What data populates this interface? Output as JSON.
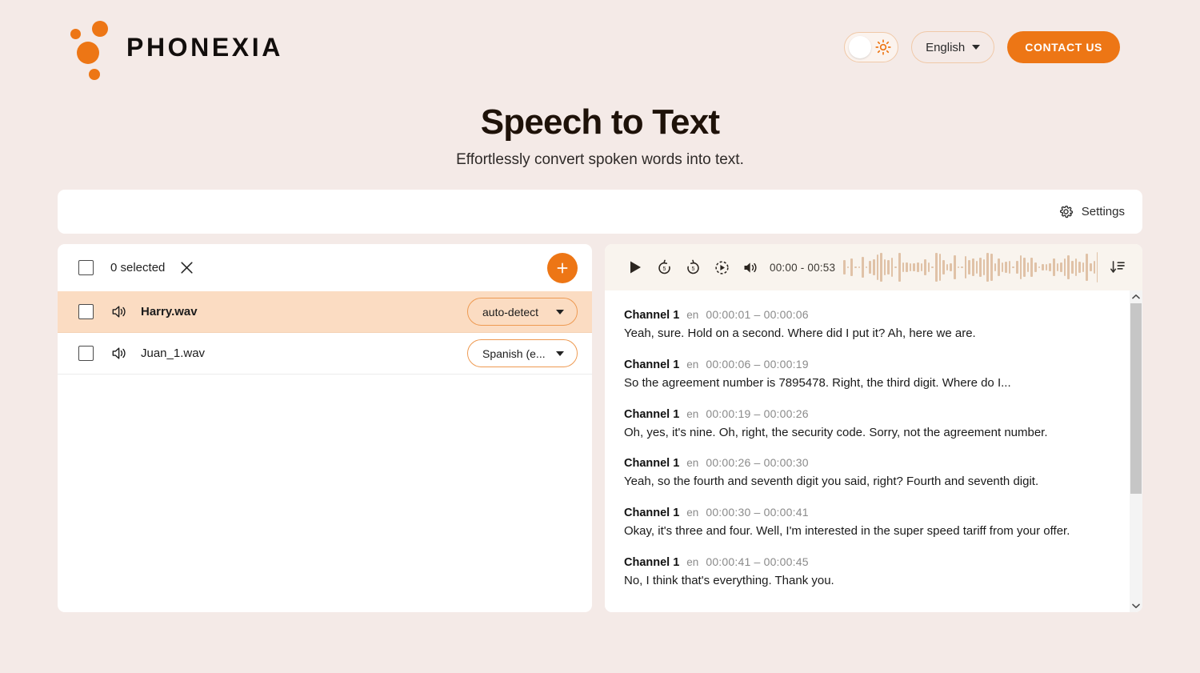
{
  "header": {
    "brand": "PHONEXIA",
    "logo_color": "#ED7615",
    "theme_toggle_icon": "sun-icon",
    "language": "English",
    "contact_label": "CONTACT US",
    "contact_color": "#ED7615"
  },
  "hero": {
    "title": "Speech to Text",
    "subtitle": "Effortlessly convert spoken words into text."
  },
  "settings_bar": {
    "icon": "gear-icon",
    "label": "Settings"
  },
  "files_panel": {
    "toolbar": {
      "selected_label": "0 selected",
      "clear_icon": "close-icon",
      "add_icon": "plus-icon"
    },
    "items": [
      {
        "icon": "speaker-icon",
        "name": "Harry.wav",
        "language": "auto-detect",
        "selected": false,
        "active": true
      },
      {
        "icon": "speaker-icon",
        "name": "Juan_1.wav",
        "language": "Spanish (e...",
        "selected": false,
        "active": false
      }
    ]
  },
  "player": {
    "controls": [
      {
        "icon": "play-icon",
        "name": "play-button"
      },
      {
        "icon": "rewind-5-icon",
        "name": "rewind-5s-button"
      },
      {
        "icon": "forward-5-icon",
        "name": "forward-5s-button"
      },
      {
        "icon": "playback-speed-icon",
        "name": "playback-speed-button"
      },
      {
        "icon": "volume-icon",
        "name": "volume-button"
      }
    ],
    "time": "00:00 - 00:53",
    "waveform_color": "#E0C2A7",
    "sort_icon": "sort-descending-icon"
  },
  "transcript": {
    "segments": [
      {
        "channel": "Channel 1",
        "lang": "en",
        "time": "00:00:01 – 00:00:06",
        "text": "Yeah, sure. Hold on a second. Where did I put it? Ah, here we are."
      },
      {
        "channel": "Channel 1",
        "lang": "en",
        "time": "00:00:06 – 00:00:19",
        "text": "So the agreement number is 7895478. Right, the third digit. Where do I..."
      },
      {
        "channel": "Channel 1",
        "lang": "en",
        "time": "00:00:19 – 00:00:26",
        "text": "Oh, yes, it's nine. Oh, right, the security code. Sorry, not the agreement number."
      },
      {
        "channel": "Channel 1",
        "lang": "en",
        "time": "00:00:26 – 00:00:30",
        "text": "Yeah, so the fourth and seventh digit you said, right? Fourth and seventh digit."
      },
      {
        "channel": "Channel 1",
        "lang": "en",
        "time": "00:00:30 – 00:00:41",
        "text": "Okay, it's three and four. Well, I'm interested in the super speed tariff from your offer."
      },
      {
        "channel": "Channel 1",
        "lang": "en",
        "time": "00:00:41 – 00:00:45",
        "text": "No, I think that's everything. Thank you."
      }
    ]
  },
  "theme": {
    "page_background": "#F4EAE7",
    "accent": "#ED7615",
    "active_row": "#FBDCC2",
    "player_background": "#F9F4EE"
  }
}
